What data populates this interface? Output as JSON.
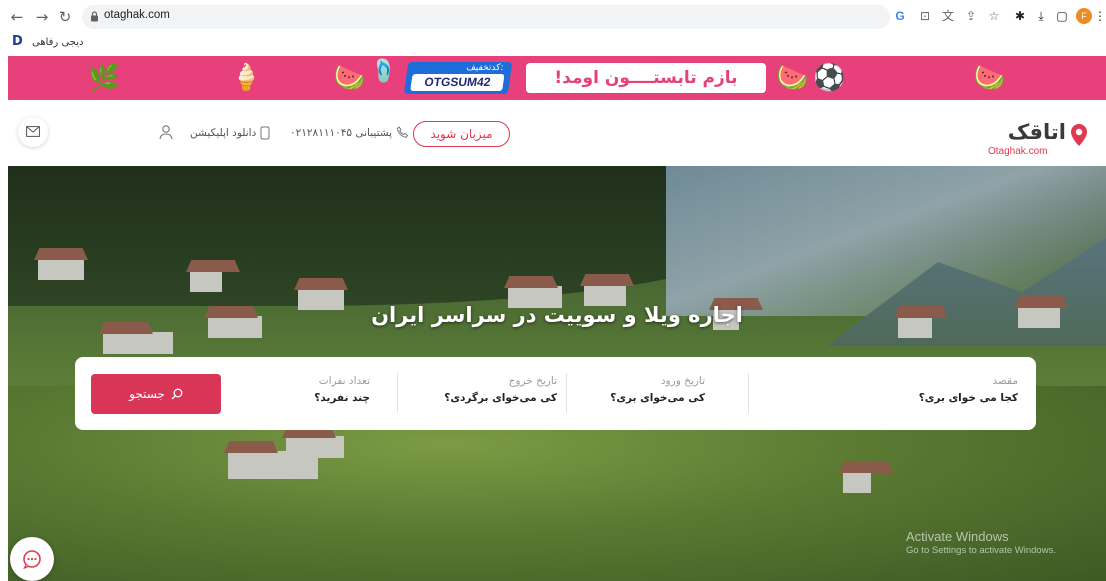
{
  "browser": {
    "url": "otaghak.com",
    "bookmark_label": "دیجی رفاهی",
    "bookmark_icon": "D",
    "profile_initial": "F",
    "icons": [
      "back-icon",
      "forward-icon",
      "reload-icon",
      "lock-icon",
      "google-icon",
      "install-icon",
      "translate-icon",
      "share-icon",
      "star-icon",
      "extensions-icon",
      "download-icon",
      "sidepanel-icon",
      "profile-avatar",
      "menu-icon"
    ]
  },
  "banner": {
    "promo_label": "کدتخفیف:",
    "promo_code": "OTGSUM42",
    "slogan": "بازم تابستــــون اومد!",
    "color": "#e8407a",
    "accent": "#1e6dd8"
  },
  "header": {
    "logo_name": "اتاقک",
    "logo_sub": "Otaghak.com",
    "host_button": "میزبان شوید",
    "support_text": "پشتیبانی ۰۲۱۲۸۱۱۱۰۴۵",
    "download_text": "دانلود اپلیکیشن",
    "brand_color": "#e2394f"
  },
  "hero": {
    "title": "اجاره ویلا و سوییت در سراسر ایران"
  },
  "search": {
    "destination": {
      "label": "مقصد",
      "value": "کجا می خوای بری؟"
    },
    "checkin": {
      "label": "تاریخ ورود",
      "value": "کی می‌خوای بری؟"
    },
    "checkout": {
      "label": "تاریخ خروج",
      "value": "کی می‌خوای برگردی؟"
    },
    "guests": {
      "label": "تعداد نفرات",
      "value": "چند نفرید؟"
    },
    "button": "جستجو",
    "button_color": "#d93557"
  },
  "watermark": {
    "title": "Activate Windows",
    "subtitle": "Go to Settings to activate Windows."
  }
}
